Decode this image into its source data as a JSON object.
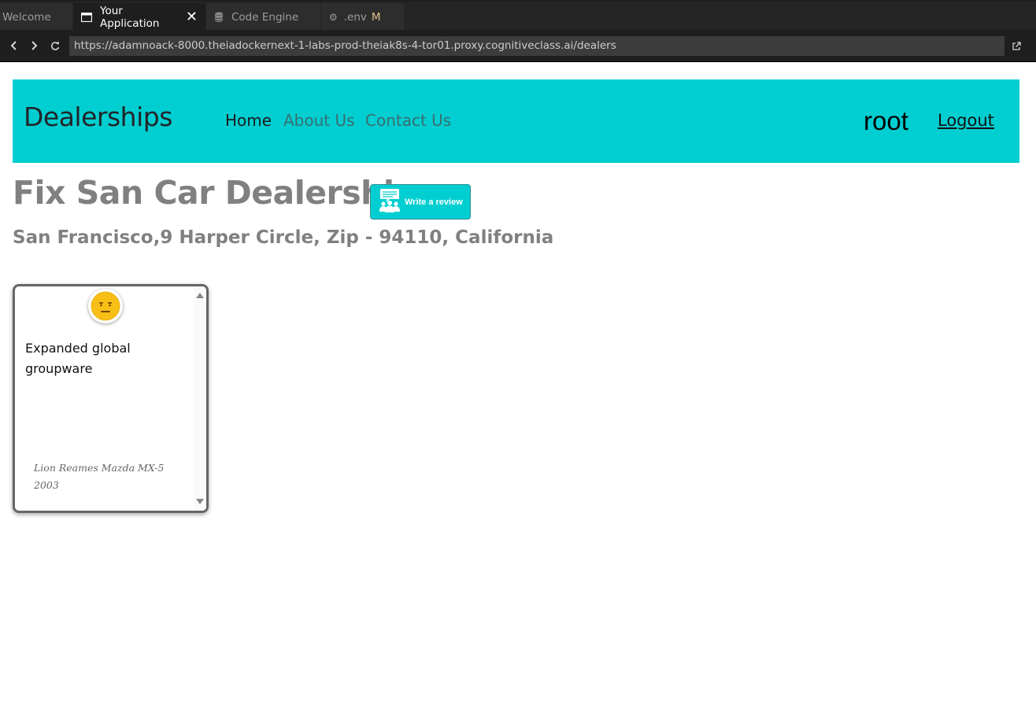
{
  "ide": {
    "tabs": [
      {
        "label": "Welcome",
        "icon": "none",
        "active": false
      },
      {
        "label": "Your Application",
        "icon": "window-icon",
        "active": true
      },
      {
        "label": "Code Engine",
        "icon": "database-icon",
        "active": false
      },
      {
        "label": ".env",
        "icon": "gear-icon",
        "active": false,
        "modified": "M"
      }
    ]
  },
  "browser": {
    "url": "https://adamnoack-8000.theiadockernext-1-labs-prod-theiak8s-4-tor01.proxy.cognitiveclass.ai/dealers"
  },
  "navbar": {
    "brand": "Dealerships",
    "links": [
      "Home",
      "About Us",
      "Contact Us"
    ],
    "username": "root",
    "logout": "Logout",
    "color": "#00ced1"
  },
  "dealer": {
    "title": "Fix San Car Dealership",
    "address": "San Francisco,9 Harper Circle, Zip - 94110, California",
    "write_review_label": "Write a review"
  },
  "reviews": [
    {
      "sentiment": "neutral",
      "sentiment_icon": "neutral-face-icon",
      "text": "Expanded global groupware",
      "meta": "Lion Reames Mazda MX-5 2003"
    }
  ]
}
